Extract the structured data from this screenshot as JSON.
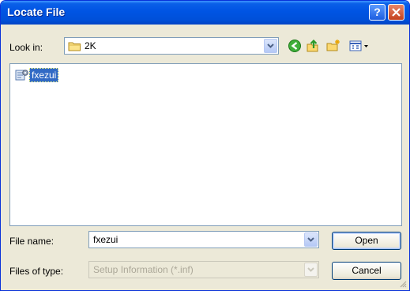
{
  "window": {
    "title": "Locate File",
    "help_label": "?",
    "close_label": "X"
  },
  "toolbar": {
    "look_in_label": "Look in:",
    "look_in_value": "2K",
    "icons": [
      "folder-icon",
      "back-icon",
      "up-folder-icon",
      "new-folder-icon",
      "views-menu-icon"
    ]
  },
  "file_list": {
    "items": [
      {
        "name": "fxezui",
        "icon": "setup-file-icon",
        "selected": true
      }
    ]
  },
  "file_name": {
    "label": "File name:",
    "value": "fxezui"
  },
  "file_type": {
    "label": "Files of type:",
    "value": "Setup Information (*.inf)"
  },
  "buttons": {
    "open": "Open",
    "cancel": "Cancel"
  },
  "colors": {
    "title_bar": "#0054e3",
    "selection": "#316ac5",
    "dialog_bg": "#ece9d8"
  }
}
